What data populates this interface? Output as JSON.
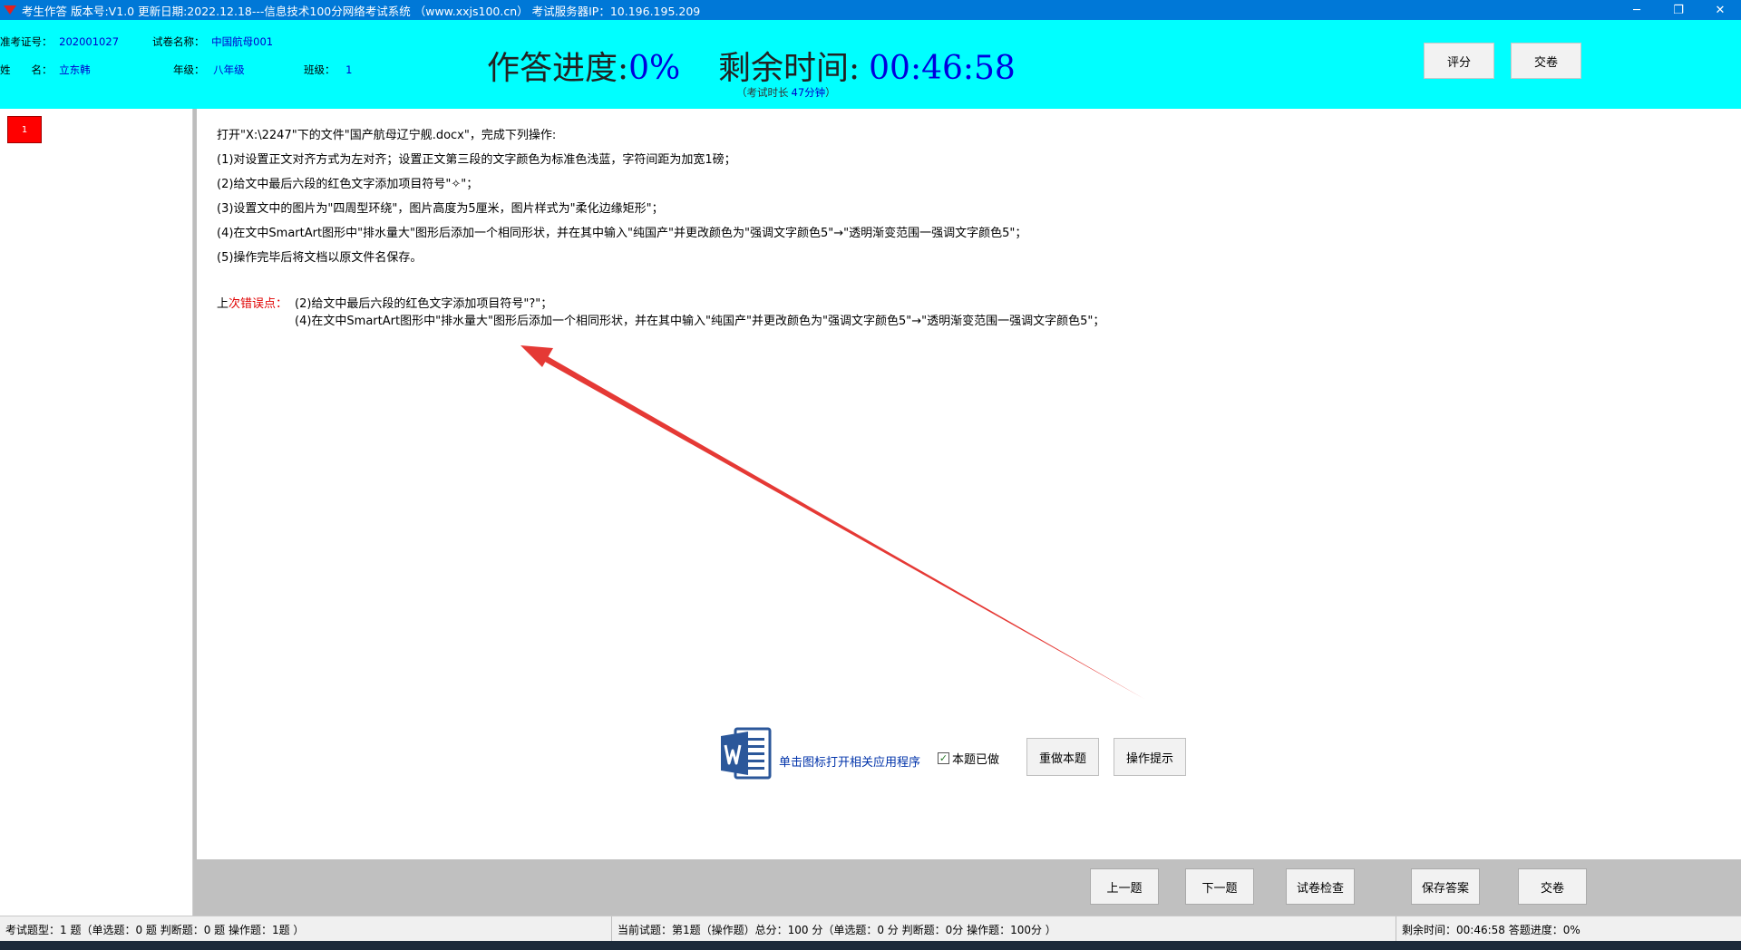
{
  "window": {
    "title": "考生作答 版本号:V1.0 更新日期:2022.12.18---信息技术100分网络考试系统 （www.xxjs100.cn） 考试服务器IP：10.196.195.209",
    "minimize_glyph": "─",
    "restore_glyph": "❐",
    "close_glyph": "✕"
  },
  "header": {
    "exam_id_label": "准考证号：",
    "exam_id": "202001027",
    "paper_label": "试卷名称：",
    "paper_name": "中国航母001",
    "name_label": "姓　　名：",
    "name": "立东韩",
    "grade_label": "年级：",
    "grade": "八年级",
    "class_label": "班级：",
    "class": "1",
    "progress_label": "作答进度:",
    "progress_value": "0%",
    "remaining_label": "剩余时间:",
    "remaining_value": "00:46:58",
    "duration_prefix": "（考试时长",
    "duration_value": "47分钟",
    "duration_suffix": "）",
    "score_button": "评分",
    "submit_button": "交卷"
  },
  "question_list": {
    "items": [
      {
        "number": "1"
      }
    ]
  },
  "question": {
    "lines": [
      "打开\"X:\\2247\"下的文件\"国产航母辽宁舰.docx\"，完成下列操作:",
      "(1)对设置正文对齐方式为左对齐；设置正文第三段的文字颜色为标准色浅蓝，字符间距为加宽1磅；",
      "(2)给文中最后六段的红色文字添加项目符号\"✧\"；",
      "(3)设置文中的图片为\"四周型环绕\"，图片高度为5厘米，图片样式为\"柔化边缘矩形\"；",
      "(4)在文中SmartArt图形中\"排水量大\"图形后添加一个相同形状，并在其中输入\"纯国产\"并更改颜色为\"强调文字颜色5\"→\"透明渐变范围一强调文字颜色5\"；",
      "(5)操作完毕后将文档以原文件名保存。"
    ],
    "last_errors_label_a": "上",
    "last_errors_label_b": "次错误点：",
    "last_errors": [
      "(2)给文中最后六段的红色文字添加项目符号\"?\"；",
      "(4)在文中SmartArt图形中\"排水量大\"图形后添加一个相同形状，并在其中输入\"纯国产\"并更改颜色为\"强调文字颜色5\"→\"透明渐变范围一强调文字颜色5\"；"
    ]
  },
  "actions": {
    "open_app_link": "单击图标打开相关应用程序",
    "done_checkbox_label": "本题已做",
    "done_checked": true,
    "check_glyph": "✓",
    "redo_button": "重做本题",
    "hint_button": "操作提示"
  },
  "bottom_buttons": {
    "prev": "上一题",
    "next": "下一题",
    "check": "试卷检查",
    "save": "保存答案",
    "submit": "交卷"
  },
  "status": {
    "types": "考试题型：1 题（单选题：0 题 判断题：0 题 操作题：1题 ）",
    "current": "当前试题：第1题（操作题）总分：100 分（单选题：0 分 判断题：0分 操作题：100分 ）",
    "remaining": "剩余时间：00:46:58 答题进度：0%"
  },
  "colors": {
    "header_bg": "#00ffff",
    "titlebar_bg": "#0078d7",
    "value_blue": "#0000cc",
    "error_red": "#e00000",
    "annotation_red": "#e53935",
    "word_blue": "#2b579a"
  },
  "icons": {
    "app": "exam-app-icon",
    "word": "word-icon"
  }
}
